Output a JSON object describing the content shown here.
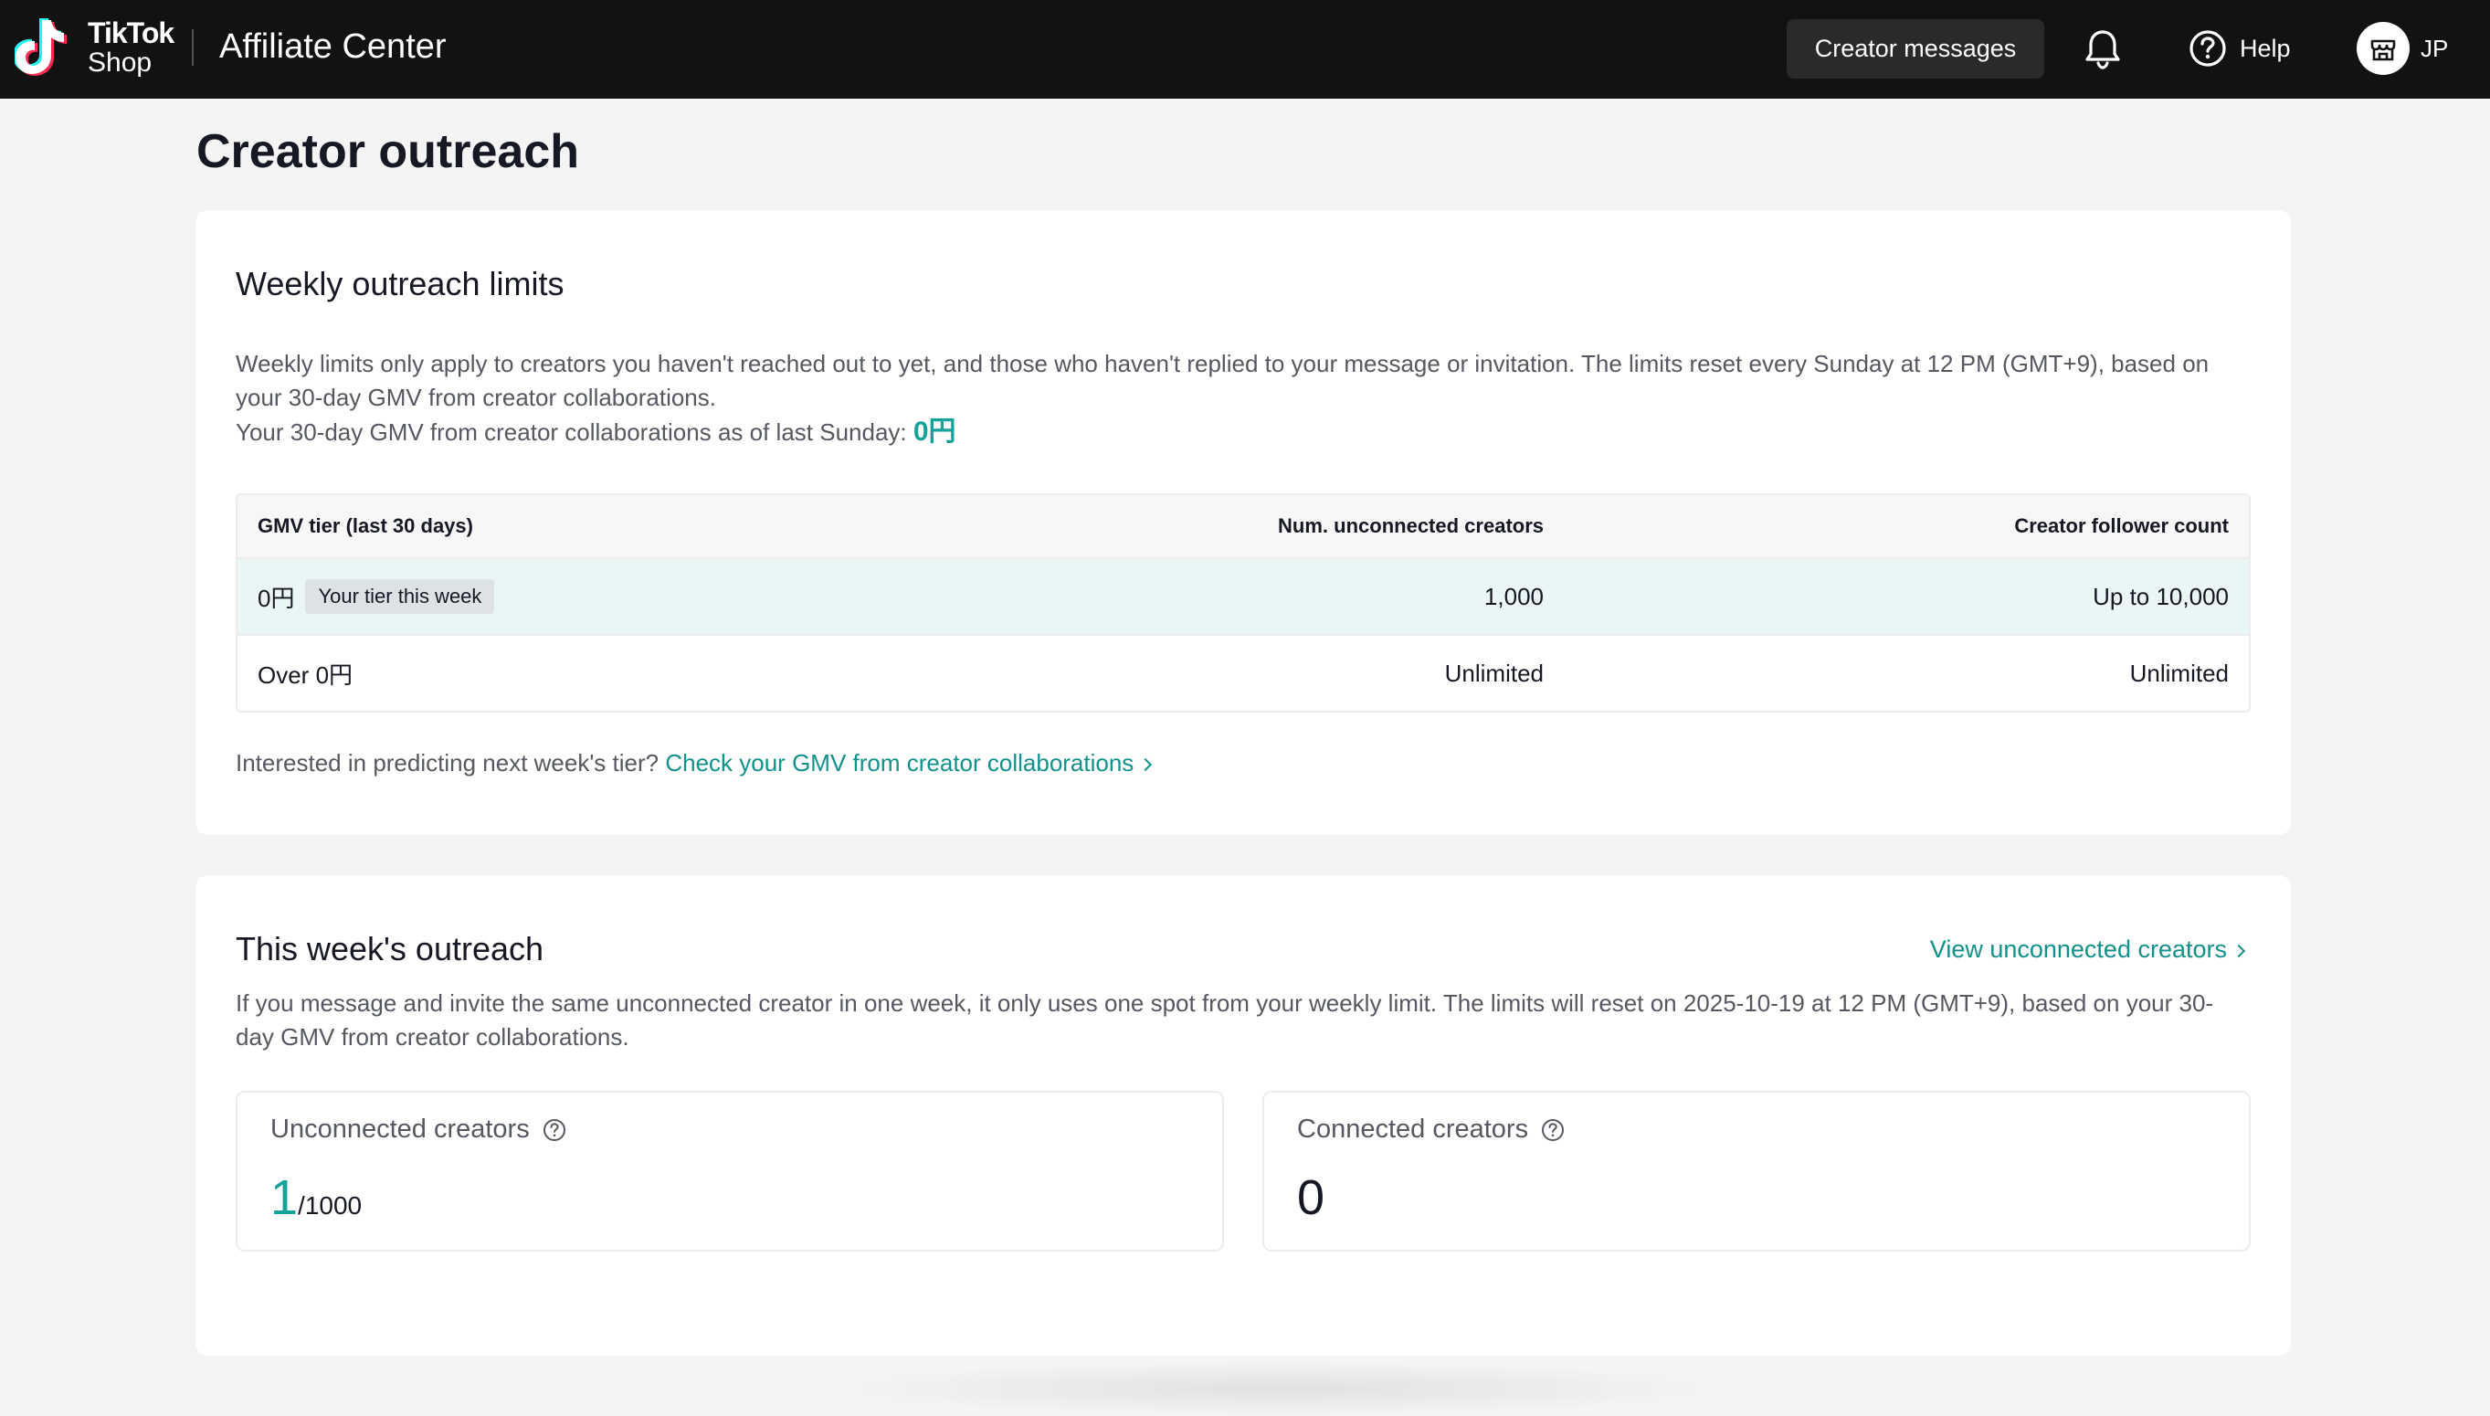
{
  "header": {
    "brand_line1": "TikTok",
    "brand_line2": "Shop",
    "app_title": "Affiliate Center",
    "creator_messages": "Creator messages",
    "help": "Help",
    "account": "JP"
  },
  "page": {
    "title": "Creator outreach"
  },
  "weekly_limits": {
    "title": "Weekly outreach limits",
    "desc_line1": "Weekly limits only apply to creators you haven't reached out to yet, and those who haven't replied to your message or invitation. The limits reset every Sunday at 12 PM (GMT+9), based on",
    "desc_line2": "your 30-day GMV from creator collaborations.",
    "gmv_label": "Your 30-day GMV from creator collaborations as of last Sunday:",
    "gmv_value": "0円",
    "table": {
      "headers": [
        "GMV tier (last 30 days)",
        "Num. unconnected creators",
        "Creator follower count"
      ],
      "rows": [
        {
          "tier": "0円",
          "badge": "Your tier this week",
          "num": "1,000",
          "followers": "Up to 10,000"
        },
        {
          "tier": "Over 0円",
          "num": "Unlimited",
          "followers": "Unlimited"
        }
      ]
    },
    "predict_text": "Interested in predicting next week's tier?",
    "predict_link": "Check your GMV from creator collaborations"
  },
  "this_week": {
    "title": "This week's outreach",
    "view_link": "View unconnected creators",
    "desc_line1": "If you message and invite the same unconnected creator in one week, it only uses one spot from your weekly limit. The limits will reset on 2025-10-19 at 12 PM (GMT+9), based on your 30-",
    "desc_line2": "day GMV from creator collaborations.",
    "unconnected": {
      "label": "Unconnected creators",
      "value": "1",
      "limit": "/1000"
    },
    "connected": {
      "label": "Connected creators",
      "value": "0"
    }
  },
  "colors": {
    "accent": "#13a39b",
    "topbar": "#121212",
    "tier_highlight": "#eaf6f5"
  },
  "icons": [
    "tiktok-logo-icon",
    "bell-icon",
    "help-circle-icon",
    "store-icon",
    "question-icon",
    "chevron-right-icon"
  ]
}
